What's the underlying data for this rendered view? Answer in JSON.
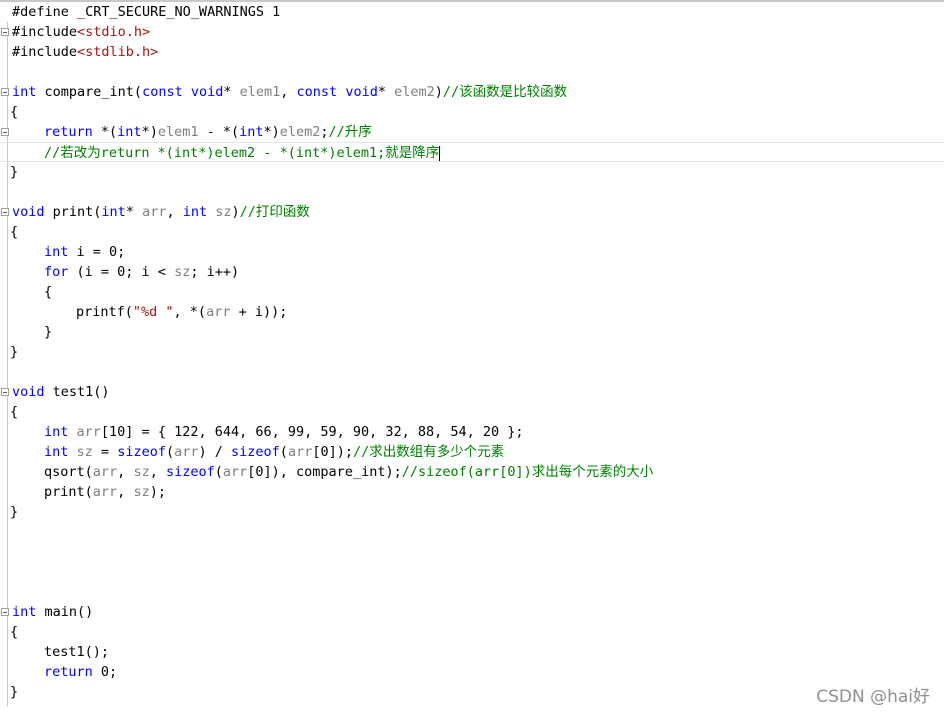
{
  "editor": {
    "lines": [
      "#define _CRT_SECURE_NO_WARNINGS 1",
      "#include<stdio.h>",
      "#include<stdlib.h>",
      "",
      "int compare_int(const void* elem1, const void* elem2)//该函数是比较函数",
      "{",
      "    return *(int*)elem1 - *(int*)elem2;//升序",
      "    //若改为return *(int*)elem2 - *(int*)elem1;就是降序",
      "}",
      "",
      "void print(int* arr, int sz)//打印函数",
      "{",
      "    int i = 0;",
      "    for (i = 0; i < sz; i++)",
      "    {",
      "        printf(\"%d \", *(arr + i));",
      "    }",
      "}",
      "",
      "void test1()",
      "{",
      "    int arr[10] = { 122, 644, 66, 99, 59, 90, 32, 88, 54, 20 };",
      "    int sz = sizeof(arr) / sizeof(arr[0]);//求出数组有多少个元素",
      "    qsort(arr, sz, sizeof(arr[0]), compare_int);//sizeof(arr[0])求出每个元素的大小",
      "    print(arr, sz);",
      "}",
      "",
      "",
      "",
      "int main()",
      "{",
      "    test1();",
      "    return 0;",
      "}"
    ],
    "colors": {
      "keyword": "#0000ff",
      "comment": "#008000",
      "string": "#a31515",
      "parameter": "#808080",
      "text": "#000000"
    }
  },
  "watermark": {
    "text": "CSDN @hai好"
  }
}
